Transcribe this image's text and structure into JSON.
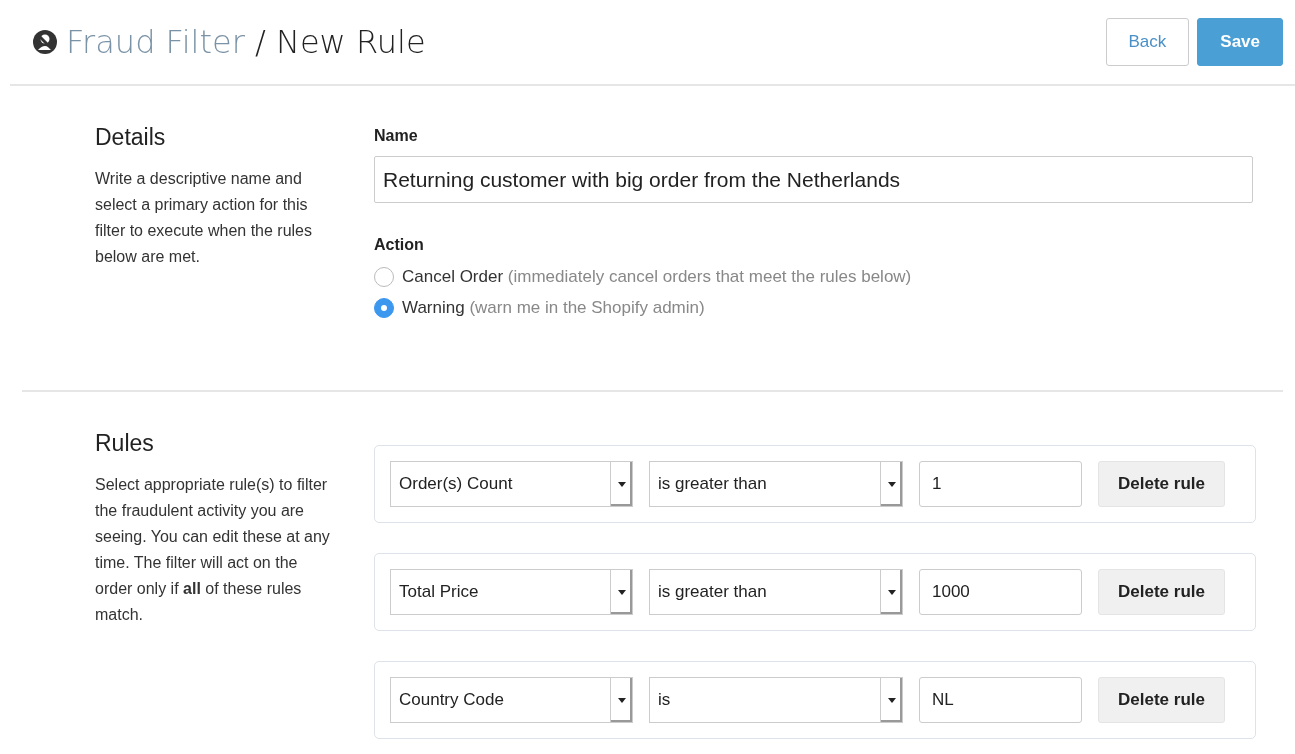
{
  "header": {
    "breadcrumb_link": "Fraud Filter",
    "separator": "/",
    "title": "New Rule",
    "buttons": [
      {
        "label": "Back",
        "kind": "secondary"
      },
      {
        "label": "Save",
        "kind": "primary"
      }
    ]
  },
  "details": {
    "heading": "Details",
    "description": "Write a descriptive name and select a primary action for this filter to execute when the rules below are met.",
    "name_label": "Name",
    "name_value": "Returning customer with big order from the Netherlands",
    "action_label": "Action",
    "actions": [
      {
        "label": "Cancel Order",
        "hint": "(immediately cancel orders that meet the rules below)",
        "selected": false
      },
      {
        "label": "Warning",
        "hint": "(warn me in the Shopify admin)",
        "selected": true
      }
    ]
  },
  "rules": {
    "heading": "Rules",
    "description": "Select appropriate rule(s) to filter the fraudulent activity you are seeing. You can edit these at any time. The filter will act on the order only if **all** of these rules match.",
    "items": [
      {
        "field": "Order(s) Count",
        "operator": "is greater than",
        "value": "1",
        "delete_label": "Delete rule"
      },
      {
        "field": "Total Price",
        "operator": "is greater than",
        "value": "1000",
        "delete_label": "Delete rule"
      },
      {
        "field": "Country Code",
        "operator": "is",
        "value": "NL",
        "delete_label": "Delete rule"
      }
    ]
  }
}
